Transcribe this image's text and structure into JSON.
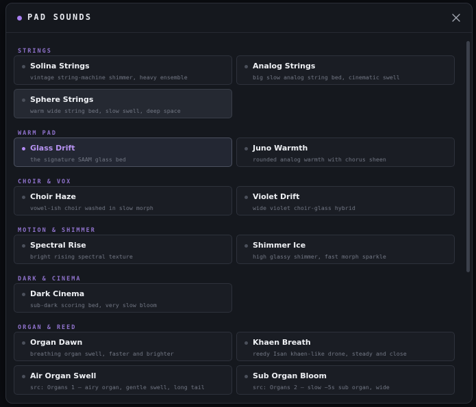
{
  "header": {
    "title": "PAD SOUNDS"
  },
  "sections": [
    {
      "label": "STRINGS",
      "items": [
        {
          "name": "Solina Strings",
          "desc": "vintage string-machine shimmer, heavy ensemble"
        },
        {
          "name": "Analog Strings",
          "desc": "big slow analog string bed, cinematic swell"
        },
        {
          "name": "Sphere Strings",
          "desc": "warm wide string bed, slow swell, deep space"
        }
      ]
    },
    {
      "label": "WARM PAD",
      "items": [
        {
          "name": "Glass Drift",
          "desc": "the signature SAAM glass bed"
        },
        {
          "name": "Juno Warmth",
          "desc": "rounded analog warmth with chorus sheen"
        }
      ]
    },
    {
      "label": "CHOIR & VOX",
      "items": [
        {
          "name": "Choir Haze",
          "desc": "vowel-ish choir washed in slow morph"
        },
        {
          "name": "Violet Drift",
          "desc": "wide violet choir-glass hybrid"
        }
      ]
    },
    {
      "label": "MOTION & SHIMMER",
      "items": [
        {
          "name": "Spectral Rise",
          "desc": "bright rising spectral texture"
        },
        {
          "name": "Shimmer Ice",
          "desc": "high glassy shimmer, fast morph sparkle"
        }
      ]
    },
    {
      "label": "DARK & CINEMA",
      "items": [
        {
          "name": "Dark Cinema",
          "desc": "sub-dark scoring bed, very slow bloom"
        }
      ]
    },
    {
      "label": "ORGAN & REED",
      "items": [
        {
          "name": "Organ Dawn",
          "desc": "breathing organ swell, faster and brighter"
        },
        {
          "name": "Khaen Breath",
          "desc": "reedy Isan khaen-like drone, steady and close"
        },
        {
          "name": "Air Organ Swell",
          "desc": "src: Organs 1 — airy organ, gentle swell, long tail"
        },
        {
          "name": "Sub Organ Bloom",
          "desc": "src: Organs 2 — slow ~5s sub organ, wide"
        }
      ]
    }
  ],
  "selected": "Glass Drift",
  "hovered": "Sphere Strings",
  "colors": {
    "accent": "#a77ef0",
    "background": "#15181e"
  }
}
